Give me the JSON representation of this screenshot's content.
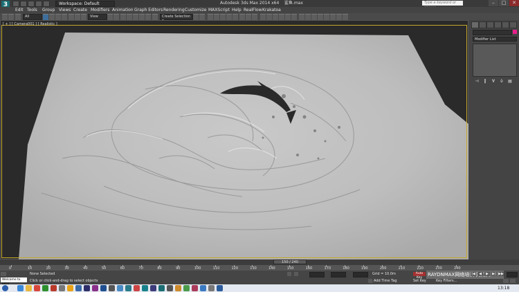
{
  "title_bar": {
    "workspace": "Workspace: Default",
    "app_title": "Autodesk 3ds Max  2014 x64",
    "file_name": "鲨鱼.max",
    "search_placeholder": "Type a keyword or phrase"
  },
  "menu": [
    "Edit",
    "Tools",
    "Group",
    "Views",
    "Create",
    "Modifiers",
    "Animation",
    "Graph Editors",
    "Rendering",
    "Customize",
    "MAXScript",
    "Help",
    "RealFlow",
    "Krakatoa"
  ],
  "toolbar": {
    "selection_filter": "All",
    "ref_coord": "View",
    "named_sel": "Create Selection Se"
  },
  "viewport": {
    "camera_label": "[ + ] [ Camera001 ]",
    "shading_label": "[ Realistic ]"
  },
  "command_panel": {
    "modifier_list": "Modifier List",
    "color_swatch": "#e91e8c"
  },
  "time_slider": {
    "frame_label": "150 / 240"
  },
  "timeline": {
    "ticks": [
      "0",
      "10",
      "20",
      "30",
      "40",
      "50",
      "60",
      "70",
      "80",
      "90",
      "100",
      "110",
      "120",
      "130",
      "140",
      "150",
      "160",
      "170",
      "180",
      "190",
      "200",
      "210",
      "220",
      "230",
      "240"
    ]
  },
  "status": {
    "maxscript": "Welcome to MAX:",
    "selection": "None Selected",
    "prompt": "Click or click-and-drag to select objects",
    "grid": "Grid = 10.0m",
    "add_time_tag": "Add Time Tag",
    "auto_key": "Auto Key",
    "set_key": "Set Key",
    "key_filters": "Key Filters...",
    "selected": "Selected",
    "watermark": "RAYDNMAX网络培训 刘力大"
  },
  "taskbar": {
    "time": "13:18"
  }
}
